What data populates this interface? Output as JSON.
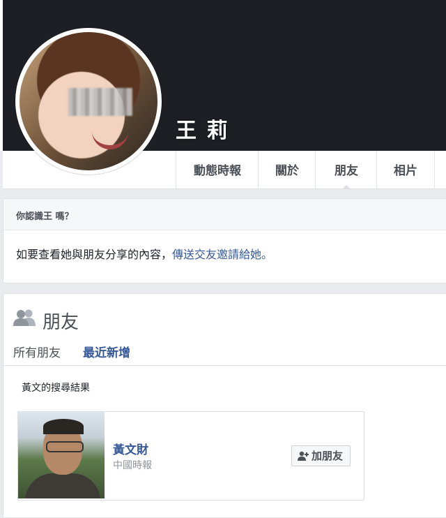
{
  "profile": {
    "name": "王 莉"
  },
  "tabs": [
    {
      "label": "動態時報"
    },
    {
      "label": "關於"
    },
    {
      "label": "朋友",
      "active": true
    },
    {
      "label": "相片"
    }
  ],
  "know_card": {
    "title": "你認識王  嗎？",
    "body_text": "如要查看她與朋友分享的內容，",
    "body_link": "傳送交友邀請給她。"
  },
  "friends": {
    "icon": "friends-icon",
    "title": "朋友",
    "subtabs": [
      {
        "label": "所有朋友",
        "active": true
      },
      {
        "label": "最近新增",
        "active": false
      }
    ],
    "results_label": "黃文的搜尋結果",
    "items": [
      {
        "name": "黃文財",
        "subtitle": "中國時報",
        "add_button": "加朋友",
        "add_icon": "add-friend-icon"
      }
    ]
  },
  "colors": {
    "link": "#365899",
    "cover": "#1d1f24",
    "page_bg": "#e9ebee"
  }
}
